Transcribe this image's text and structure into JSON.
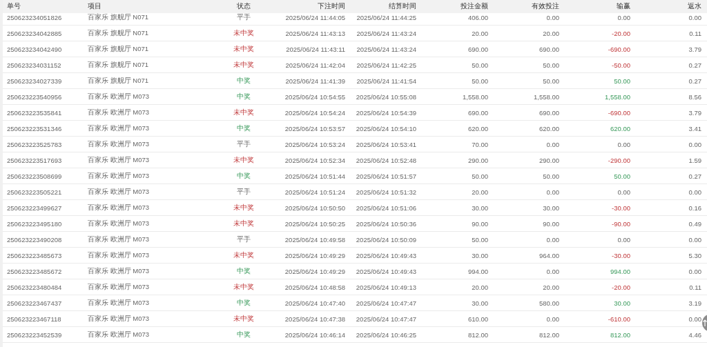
{
  "table": {
    "columns": [
      "单号",
      "项目",
      "状态",
      "下注时间",
      "结算时间",
      "投注金额",
      "有效投注",
      "输赢",
      "返水"
    ],
    "rows": [
      {
        "id": "250623234051826",
        "game": "百家乐 旗舰厅 N071",
        "status": "平手",
        "kind": "draw",
        "bet_time": "2025/06/24 11:44:05",
        "settle_time": "2025/06/24 11:44:25",
        "amount": "406.00",
        "valid": "0.00",
        "profit": "0.00",
        "rebate": "0.00"
      },
      {
        "id": "250623234042885",
        "game": "百家乐 旗舰厅 N071",
        "status": "未中奖",
        "kind": "lose",
        "bet_time": "2025/06/24 11:43:13",
        "settle_time": "2025/06/24 11:43:24",
        "amount": "20.00",
        "valid": "20.00",
        "profit": "-20.00",
        "rebate": "0.11"
      },
      {
        "id": "250623234042490",
        "game": "百家乐 旗舰厅 N071",
        "status": "未中奖",
        "kind": "lose",
        "bet_time": "2025/06/24 11:43:11",
        "settle_time": "2025/06/24 11:43:24",
        "amount": "690.00",
        "valid": "690.00",
        "profit": "-690.00",
        "rebate": "3.79"
      },
      {
        "id": "250623234031152",
        "game": "百家乐 旗舰厅 N071",
        "status": "未中奖",
        "kind": "lose",
        "bet_time": "2025/06/24 11:42:04",
        "settle_time": "2025/06/24 11:42:25",
        "amount": "50.00",
        "valid": "50.00",
        "profit": "-50.00",
        "rebate": "0.27"
      },
      {
        "id": "250623234027339",
        "game": "百家乐 旗舰厅 N071",
        "status": "中奖",
        "kind": "win",
        "bet_time": "2025/06/24 11:41:39",
        "settle_time": "2025/06/24 11:41:54",
        "amount": "50.00",
        "valid": "50.00",
        "profit": "50.00",
        "rebate": "0.27"
      },
      {
        "id": "250623223540956",
        "game": "百家乐 欧洲厅 M073",
        "status": "中奖",
        "kind": "win",
        "bet_time": "2025/06/24 10:54:55",
        "settle_time": "2025/06/24 10:55:08",
        "amount": "1,558.00",
        "valid": "1,558.00",
        "profit": "1,558.00",
        "rebate": "8.56"
      },
      {
        "id": "250623223535841",
        "game": "百家乐 欧洲厅 M073",
        "status": "未中奖",
        "kind": "lose",
        "bet_time": "2025/06/24 10:54:24",
        "settle_time": "2025/06/24 10:54:39",
        "amount": "690.00",
        "valid": "690.00",
        "profit": "-690.00",
        "rebate": "3.79"
      },
      {
        "id": "250623223531346",
        "game": "百家乐 欧洲厅 M073",
        "status": "中奖",
        "kind": "win",
        "bet_time": "2025/06/24 10:53:57",
        "settle_time": "2025/06/24 10:54:10",
        "amount": "620.00",
        "valid": "620.00",
        "profit": "620.00",
        "rebate": "3.41"
      },
      {
        "id": "250623223525783",
        "game": "百家乐 欧洲厅 M073",
        "status": "平手",
        "kind": "draw",
        "bet_time": "2025/06/24 10:53:24",
        "settle_time": "2025/06/24 10:53:41",
        "amount": "70.00",
        "valid": "0.00",
        "profit": "0.00",
        "rebate": "0.00"
      },
      {
        "id": "250623223517693",
        "game": "百家乐 欧洲厅 M073",
        "status": "未中奖",
        "kind": "lose",
        "bet_time": "2025/06/24 10:52:34",
        "settle_time": "2025/06/24 10:52:48",
        "amount": "290.00",
        "valid": "290.00",
        "profit": "-290.00",
        "rebate": "1.59"
      },
      {
        "id": "250623223508699",
        "game": "百家乐 欧洲厅 M073",
        "status": "中奖",
        "kind": "win",
        "bet_time": "2025/06/24 10:51:44",
        "settle_time": "2025/06/24 10:51:57",
        "amount": "50.00",
        "valid": "50.00",
        "profit": "50.00",
        "rebate": "0.27"
      },
      {
        "id": "250623223505221",
        "game": "百家乐 欧洲厅 M073",
        "status": "平手",
        "kind": "draw",
        "bet_time": "2025/06/24 10:51:24",
        "settle_time": "2025/06/24 10:51:32",
        "amount": "20.00",
        "valid": "0.00",
        "profit": "0.00",
        "rebate": "0.00"
      },
      {
        "id": "250623223499627",
        "game": "百家乐 欧洲厅 M073",
        "status": "未中奖",
        "kind": "lose",
        "bet_time": "2025/06/24 10:50:50",
        "settle_time": "2025/06/24 10:51:06",
        "amount": "30.00",
        "valid": "30.00",
        "profit": "-30.00",
        "rebate": "0.16"
      },
      {
        "id": "250623223495180",
        "game": "百家乐 欧洲厅 M073",
        "status": "未中奖",
        "kind": "lose",
        "bet_time": "2025/06/24 10:50:25",
        "settle_time": "2025/06/24 10:50:36",
        "amount": "90.00",
        "valid": "90.00",
        "profit": "-90.00",
        "rebate": "0.49"
      },
      {
        "id": "250623223490208",
        "game": "百家乐 欧洲厅 M073",
        "status": "平手",
        "kind": "draw",
        "bet_time": "2025/06/24 10:49:58",
        "settle_time": "2025/06/24 10:50:09",
        "amount": "50.00",
        "valid": "0.00",
        "profit": "0.00",
        "rebate": "0.00"
      },
      {
        "id": "250623223485673",
        "game": "百家乐 欧洲厅 M073",
        "status": "未中奖",
        "kind": "lose",
        "bet_time": "2025/06/24 10:49:29",
        "settle_time": "2025/06/24 10:49:43",
        "amount": "30.00",
        "valid": "964.00",
        "profit": "-30.00",
        "rebate": "5.30"
      },
      {
        "id": "250623223485672",
        "game": "百家乐 欧洲厅 M073",
        "status": "中奖",
        "kind": "win",
        "bet_time": "2025/06/24 10:49:29",
        "settle_time": "2025/06/24 10:49:43",
        "amount": "994.00",
        "valid": "0.00",
        "profit": "994.00",
        "rebate": "0.00"
      },
      {
        "id": "250623223480484",
        "game": "百家乐 欧洲厅 M073",
        "status": "未中奖",
        "kind": "lose",
        "bet_time": "2025/06/24 10:48:58",
        "settle_time": "2025/06/24 10:49:13",
        "amount": "20.00",
        "valid": "20.00",
        "profit": "-20.00",
        "rebate": "0.11"
      },
      {
        "id": "250623223467437",
        "game": "百家乐 欧洲厅 M073",
        "status": "中奖",
        "kind": "win",
        "bet_time": "2025/06/24 10:47:40",
        "settle_time": "2025/06/24 10:47:47",
        "amount": "30.00",
        "valid": "580.00",
        "profit": "30.00",
        "rebate": "3.19"
      },
      {
        "id": "250623223467118",
        "game": "百家乐 欧洲厅 M073",
        "status": "未中奖",
        "kind": "lose",
        "bet_time": "2025/06/24 10:47:38",
        "settle_time": "2025/06/24 10:47:47",
        "amount": "610.00",
        "valid": "0.00",
        "profit": "-610.00",
        "rebate": "0.00"
      },
      {
        "id": "250623223452539",
        "game": "百家乐 欧洲厅 M073",
        "status": "中奖",
        "kind": "win",
        "bet_time": "2025/06/24 10:46:14",
        "settle_time": "2025/06/24 10:46:25",
        "amount": "812.00",
        "valid": "812.00",
        "profit": "812.00",
        "rebate": "4.46"
      }
    ]
  }
}
